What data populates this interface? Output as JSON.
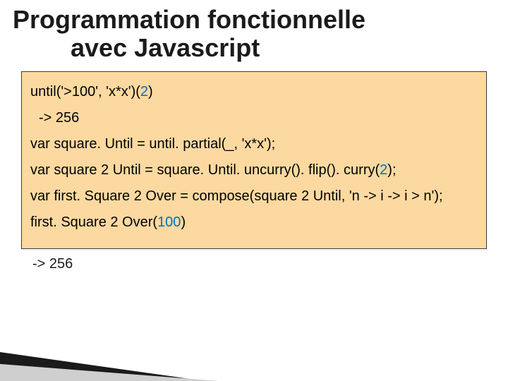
{
  "title": {
    "line1": "Programmation fonctionnelle",
    "line2": "avec Javascript"
  },
  "code": {
    "l1a": "until('>100', 'x*x')(",
    "l1b": "2",
    "l1c": ")",
    "l2": "-> 256",
    "l3": "var square. Until = until. partial(_, 'x*x');",
    "l4a": "var square 2 Until = square. Until. uncurry(). flip(). curry(",
    "l4b": "2",
    "l4c": ");",
    "l5": "var first. Square 2 Over = compose(square 2 Until, 'n -> i -> i > n');",
    "l6a": "first. Square 2 Over(",
    "l6b": "100",
    "l6c": ")"
  },
  "result": "-> 256"
}
